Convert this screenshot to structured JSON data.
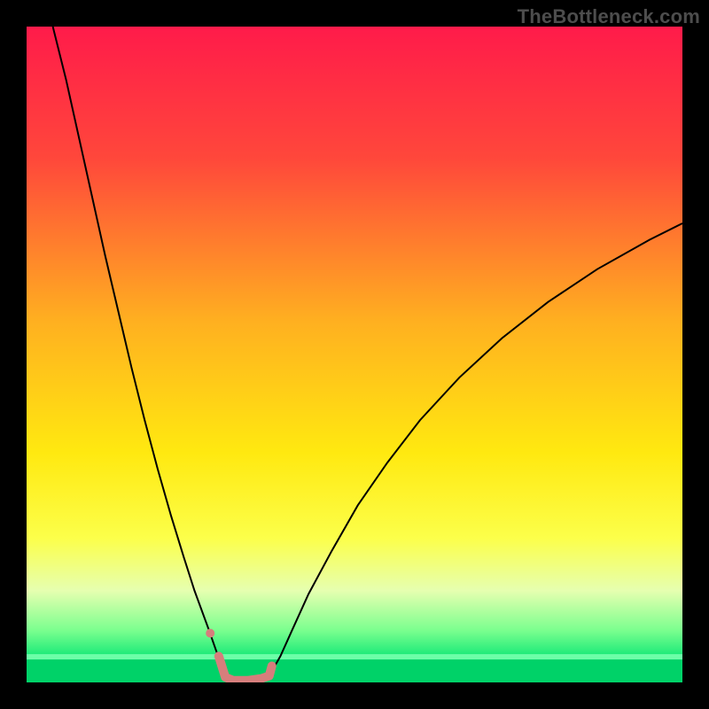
{
  "watermark": "TheBottleneck.com",
  "chart_data": {
    "type": "line",
    "title": "",
    "xlabel": "",
    "ylabel": "",
    "xlim": [
      0,
      100
    ],
    "ylim": [
      0,
      100
    ],
    "background_gradient": {
      "stops": [
        {
          "offset": 0.0,
          "color": "#ff1b4a"
        },
        {
          "offset": 0.2,
          "color": "#ff473b"
        },
        {
          "offset": 0.45,
          "color": "#ffb020"
        },
        {
          "offset": 0.65,
          "color": "#ffe910"
        },
        {
          "offset": 0.78,
          "color": "#fcff4a"
        },
        {
          "offset": 0.86,
          "color": "#e6ffb0"
        },
        {
          "offset": 0.92,
          "color": "#7cff8f"
        },
        {
          "offset": 0.97,
          "color": "#00e472"
        },
        {
          "offset": 1.0,
          "color": "#00c45a"
        }
      ]
    },
    "series": [
      {
        "name": "curve-left",
        "stroke": "#000000",
        "stroke_width": 2.0,
        "x": [
          4.0,
          6.0,
          8.0,
          10.0,
          12.0,
          14.0,
          16.0,
          18.0,
          20.0,
          22.0,
          24.0,
          25.6,
          27.8,
          29.2,
          30.3
        ],
        "y": [
          100.0,
          92.0,
          83.0,
          74.0,
          65.0,
          56.5,
          48.0,
          40.0,
          32.5,
          25.5,
          19.0,
          14.0,
          8.0,
          4.0,
          0.8
        ]
      },
      {
        "name": "curve-right",
        "stroke": "#000000",
        "stroke_width": 2.0,
        "x": [
          37.0,
          38.7,
          40.5,
          43.0,
          46.5,
          50.5,
          55.0,
          60.0,
          66.0,
          72.5,
          79.5,
          87.0,
          95.0,
          100.0
        ],
        "y": [
          1.0,
          4.0,
          8.0,
          13.5,
          20.0,
          27.0,
          33.5,
          40.0,
          46.5,
          52.5,
          58.0,
          63.0,
          67.5,
          70.0
        ]
      },
      {
        "name": "highlight-band",
        "stroke": "#d67e7c",
        "stroke_width": 10.0,
        "linecap": "round",
        "x": [
          29.3,
          30.3,
          31.5,
          33.7,
          35.8,
          37.0,
          37.4
        ],
        "y": [
          4.0,
          0.8,
          0.3,
          0.3,
          0.6,
          1.0,
          2.5
        ]
      },
      {
        "name": "highlight-dot",
        "type": "scatter",
        "fill": "#d67e7c",
        "radius": 5.0,
        "x": [
          28.0
        ],
        "y": [
          7.5
        ]
      }
    ],
    "green_strip": {
      "y0": 0.0,
      "y1": 3.5
    }
  }
}
